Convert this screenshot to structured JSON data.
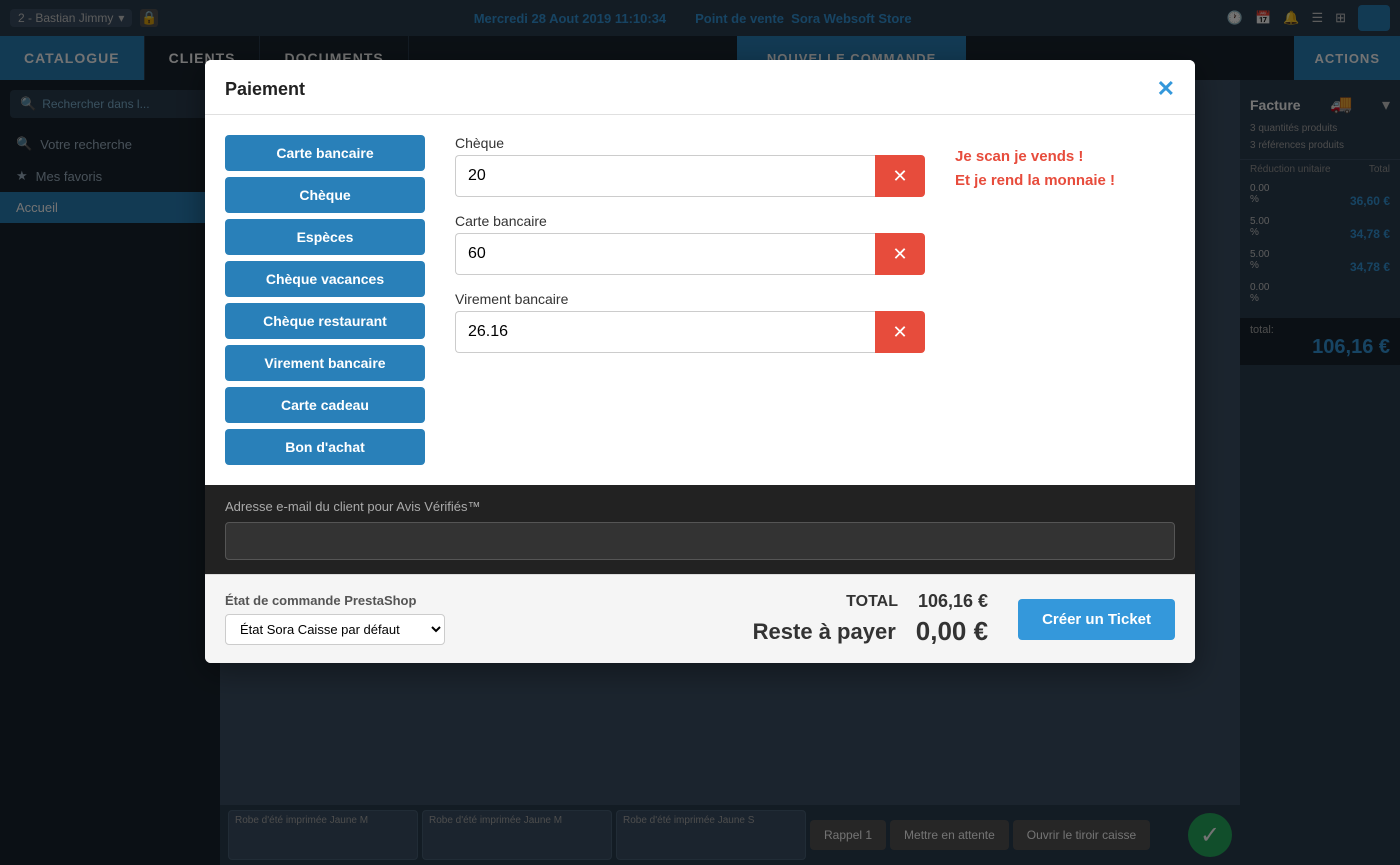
{
  "topbar": {
    "datetime": "Mercredi 28 Aout 2019 11:10:34",
    "pos_label": "Point de vente",
    "store_name": "Sora Websoft Store",
    "user": "2 - Bastian Jimmy"
  },
  "nav": {
    "catalogue": "CATALOGUE",
    "clients": "CLIENTS",
    "documents": "DOCUMENTS",
    "actions": "ACTIONS"
  },
  "sidebar": {
    "search_placeholder": "Rechercher dans l...",
    "menu_items": [
      {
        "label": "Votre recherche",
        "icon": "🔍"
      },
      {
        "label": "Mes favoris",
        "icon": "★"
      },
      {
        "label": "Accueil",
        "icon": ""
      }
    ]
  },
  "right_panel": {
    "title": "Facture",
    "quantities": "3 quantités produits",
    "references": "3 références produits",
    "reduction_label": "Réduction unitaire",
    "total_label": "Total",
    "rows": [
      {
        "reduction": "0.00",
        "percent": "%",
        "total": "36,60 €"
      },
      {
        "reduction": "5.00",
        "percent": "%",
        "total": "34,78 €"
      },
      {
        "reduction": "5.00",
        "percent": "%",
        "total": "34,78 €"
      },
      {
        "reduction": "0.00",
        "percent": "%",
        "total": ""
      }
    ],
    "grand_total_label": "total:",
    "grand_total": "106,16 €"
  },
  "bottom_bar": {
    "products": [
      {
        "name": "Robe d'été imprimée Jaune M"
      },
      {
        "name": "Robe d'été imprimée Jaune M"
      },
      {
        "name": "Robe d'été imprimée Jaune S"
      }
    ],
    "btn_rappel": "Rappel 1",
    "btn_attente": "Mettre en attente",
    "btn_tiroir": "Ouvrir le tiroir caisse"
  },
  "modal": {
    "title": "Paiement",
    "close_label": "✕",
    "payment_methods": [
      "Carte bancaire",
      "Chèque",
      "Espèces",
      "Chèque vacances",
      "Chèque restaurant",
      "Virement bancaire",
      "Carte cadeau",
      "Bon d'achat"
    ],
    "entries": [
      {
        "label": "Chèque",
        "value": "20"
      },
      {
        "label": "Carte bancaire",
        "value": "60"
      },
      {
        "label": "Virement bancaire",
        "value": "26.16"
      }
    ],
    "info_line1": "Je scan je vends !",
    "info_line2": "Et je rend la monnaie !",
    "email_label": "Adresse e-mail du client pour Avis Vérifiés™",
    "email_placeholder": "",
    "order_state_label": "État de commande PrestaShop",
    "order_state_value": "État Sora Caisse par défaut",
    "total_label": "TOTAL",
    "total_amount": "106,16 €",
    "resta_label": "Reste à payer",
    "resta_amount": "0,00 €",
    "create_ticket": "Créer un Ticket"
  }
}
